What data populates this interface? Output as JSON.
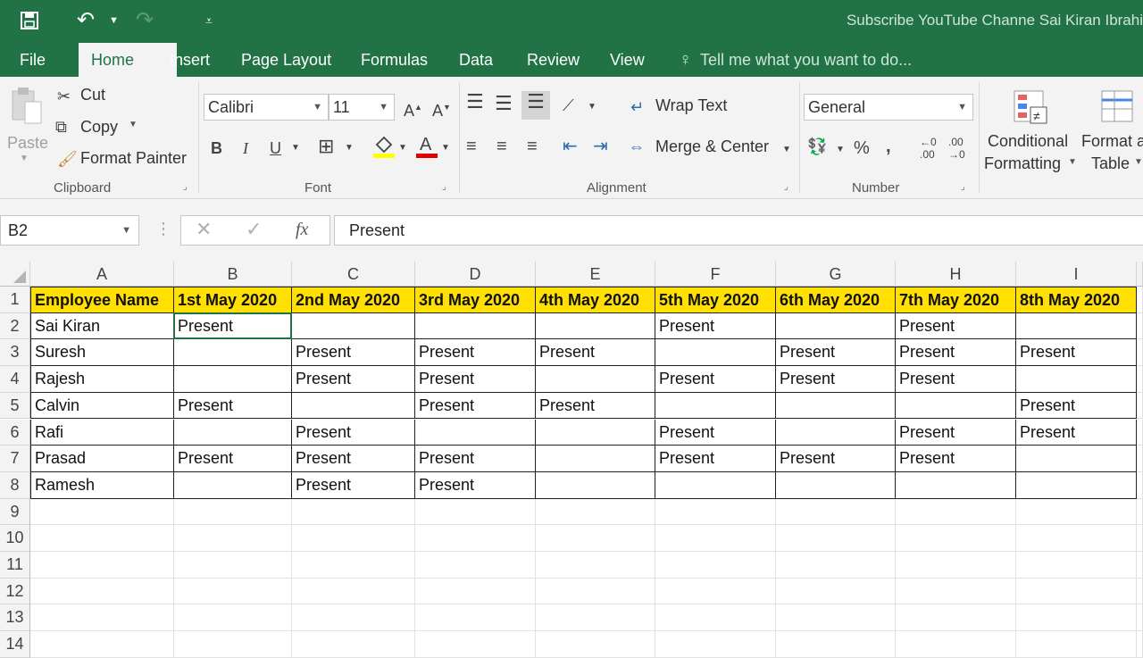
{
  "window": {
    "title": "Subscribe YouTube Channe Sai Kiran Ibrahi",
    "tabs": [
      "File",
      "Home",
      "Insert",
      "Page Layout",
      "Formulas",
      "Data",
      "Review",
      "View"
    ],
    "active_tab": "Home",
    "tell_me": "Tell me what you want to do..."
  },
  "ribbon": {
    "clipboard": {
      "label": "Clipboard",
      "paste": "Paste",
      "cut": "Cut",
      "copy": "Copy",
      "format_painter": "Format Painter"
    },
    "font": {
      "label": "Font",
      "font_name": "Calibri",
      "font_size": "11"
    },
    "alignment": {
      "label": "Alignment",
      "wrap_text": "Wrap Text",
      "merge_center": "Merge & Center"
    },
    "number": {
      "label": "Number",
      "format": "General",
      "percent": "%",
      "comma": ","
    },
    "styles": {
      "conditional_1": "Conditional",
      "conditional_2": "Formatting",
      "format_as_1": "Format a",
      "format_as_2": "Table"
    }
  },
  "formula_bar": {
    "name_box": "B2",
    "fx": "fx",
    "content": "Present"
  },
  "sheet": {
    "columns": [
      "A",
      "B",
      "C",
      "D",
      "E",
      "F",
      "G",
      "H",
      "I"
    ],
    "rows": [
      "1",
      "2",
      "3",
      "4",
      "5",
      "6",
      "7",
      "8",
      "9",
      "10",
      "11",
      "12",
      "13",
      "14"
    ],
    "data": [
      [
        "Employee Name",
        "1st May 2020",
        "2nd May 2020",
        "3rd May 2020",
        "4th May 2020",
        "5th May 2020",
        "6th May 2020",
        "7th May 2020",
        "8th May 2020"
      ],
      [
        "Sai Kiran",
        "Present",
        "",
        "",
        "",
        "Present",
        "",
        "Present",
        ""
      ],
      [
        "Suresh",
        "",
        "Present",
        "Present",
        "Present",
        "",
        "Present",
        "Present",
        "Present"
      ],
      [
        "Rajesh",
        "",
        "Present",
        "Present",
        "",
        "Present",
        "Present",
        "Present",
        ""
      ],
      [
        "Calvin",
        "Present",
        "",
        "Present",
        "Present",
        "",
        "",
        "",
        "Present"
      ],
      [
        "Rafi",
        "",
        "Present",
        "",
        "",
        "Present",
        "",
        "Present",
        "Present"
      ],
      [
        "Prasad",
        "Present",
        "Present",
        "Present",
        "",
        "Present",
        "Present",
        "Present",
        ""
      ],
      [
        "Ramesh",
        "",
        "Present",
        "Present",
        "",
        "",
        "",
        "",
        ""
      ]
    ]
  },
  "colors": {
    "excel_green": "#217346",
    "header_fill": "#ffe000"
  }
}
